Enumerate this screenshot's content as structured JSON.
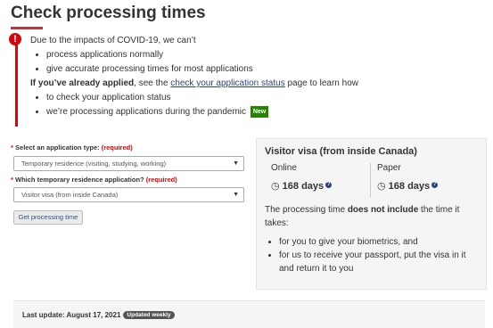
{
  "page": {
    "title": "Check processing times"
  },
  "alert": {
    "icon": "!",
    "intro": "Due to the impacts of COVID-19, we can’t",
    "cant_items": [
      "process applications normally",
      "give accurate processing times for most applications"
    ],
    "applied_bold": "If you’ve already applied",
    "applied_mid": ", see the ",
    "applied_link": "check your application status",
    "applied_end": " page to learn how",
    "applied_items": [
      "to check your application status",
      "we’re processing applications during the pandemic"
    ],
    "new_badge": "New"
  },
  "form": {
    "type_label": "Select an application type:",
    "type_required": "(required)",
    "type_value": "Temporary residence (visiting, studying, working)",
    "sub_label": "Which temporary residence application?",
    "sub_required": "(required)",
    "sub_value": "Visitor visa (from inside Canada)",
    "submit_label": "Get processing time",
    "required_star": "*"
  },
  "result": {
    "heading": "Visitor visa (from inside Canada)",
    "online_label": "Online",
    "online_value": "168 days",
    "paper_label": "Paper",
    "paper_value": "168 days",
    "clock_icon": "◷",
    "help_icon": "?",
    "note_start": "The processing time ",
    "note_bold": "does not include",
    "note_end": " the time it takes:",
    "items": [
      "for you to give your biometrics, and",
      "for us to receive your passport, put the visa in it and return it to you"
    ]
  },
  "update": {
    "text": "Last update: August 17, 2021",
    "badge": "Updated weekly"
  },
  "colors": {
    "alert_red": "#d3080c",
    "title_rule": "#af3c43",
    "new_green": "#278400",
    "link_blue": "#2b4380"
  }
}
